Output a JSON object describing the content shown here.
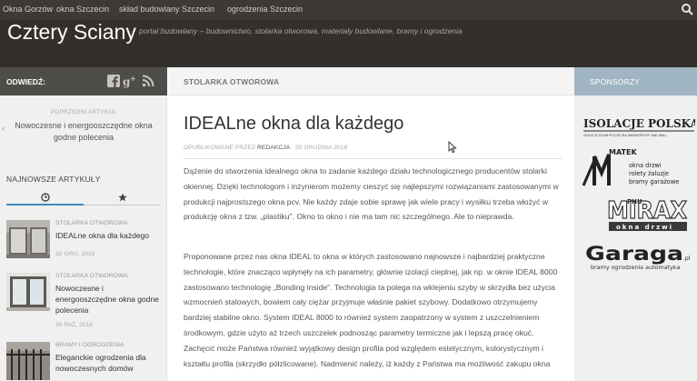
{
  "topnav": {
    "items": [
      "Okna Gorzów",
      "okna Szczecin",
      "skład budowlany Szczecin",
      "ogrodzenia Szczecin"
    ]
  },
  "header": {
    "site_title": "Cztery Sciany",
    "tagline": "portal budowlany – budownictwo, stolarka otworowa, materiały budowlane, bramy i ogrodzenia"
  },
  "left_sidebar": {
    "visit_label": "ODWIEDŹ:",
    "social_icons": [
      "facebook-icon",
      "google-plus-icon",
      "rss-icon"
    ],
    "previous": {
      "label": "POPRZEDNI ARTYKUŁ",
      "title": "Nowoczesne i energooszczędne okna godne polecenia"
    },
    "latest_label": "NAJNOWSZE ARTYKUŁY",
    "articles": [
      {
        "category": "STOLARKA OTWOROWA",
        "title": "IDEALne okna dla każdego",
        "date": "30 GRU, 2018"
      },
      {
        "category": "STOLARKA OTWOROWA",
        "title": "Nowoczesne i energooszczędne okna godne polecenia",
        "date": "30 PAŹ, 2018"
      },
      {
        "category": "BRAMY I OGRODZENIA",
        "title": "Eleganckie ogrodzenia dla nowoczesnych domów",
        "date": ""
      }
    ]
  },
  "main": {
    "category": "STOLARKA OTWOROWA",
    "title": "IDEALne okna dla każdego",
    "meta_prefix": "OPUBLIKOWANE PRZEZ",
    "meta_author": "REDAKCJA",
    "meta_date": "· 30 GRUDNIA 2018",
    "paragraphs": [
      "Dążenie do stworzenia idealnego okna to zadanie każdego działu technologicznego producentów stolarki okiennej. Dzięki technologom i inżynierom możemy cieszyć się najlepszymi rozwiązaniami zastosowanymi w produkcji najprostszego okna pcv. Nie każdy zdaje sobie sprawę jak wiele pracy i wysiłku trzeba włożyć w produkcję okna z tzw. „plastiku\". Okno to okno i nie ma tam nic szczególnego. Ale to nieprawda.",
      "Proponowane przez nas okna IDEAL to okna w których zastosowano najnowsze i najbardziej praktyczne technologie, które znacząco wpłynęły na ich parametry, głównie izolacji cieplnej, jak np. w oknie IDEAL 8000 zastosowano technologię „Bonding inside\". Technologia ta polega na wklejeniu szyby w skrzydła bez użycia wzmocnień stalowych, bowiem cały ciężar przyjmuje właśnie pakiet szybowy. Dodatkowo otrzymujemy bardziej stabilne okno. System IDEAL 8000 to również system zaopatrzony w system z uszczelnieniem środkowym, gdzie użyto aż trzech uszczelek podnosząc parametry termiczne jak i lepszą pracę okuć. Zachęcić może Państwa również wyjątkowy design profila pod względem estetycznym, kolorystycznym i kształtu profila (skrzydło półzlicowane). Nadmienić należy, iż każdy z Państwa ma możliwość zakupu okna"
    ]
  },
  "right_sidebar": {
    "label": "SPONSORZY",
    "sponsors": [
      {
        "name": "ISOLACJE POLSKA",
        "sub": "IZOLACJE ŚCIAN•RĄCZKI NA WANDSPROOF AND WALL"
      },
      {
        "name": "MATEK",
        "lines": [
          "okna drzwi",
          "rolety żaluzje",
          "bramy garażowe"
        ]
      },
      {
        "name": "PHU MIRAX",
        "sub": "okna drzwi"
      },
      {
        "name": "Garaga",
        "domain": ".pl",
        "sub": "bramy ogrodzenia automatyka"
      }
    ]
  },
  "colors": {
    "topnav_bg": "#3d3a36",
    "header_bg": "#332f2b",
    "visit_bar_bg": "#4f4d49",
    "sponsor_bar_bg": "#9fb5c2",
    "tab_active": "#3b8dbd"
  }
}
